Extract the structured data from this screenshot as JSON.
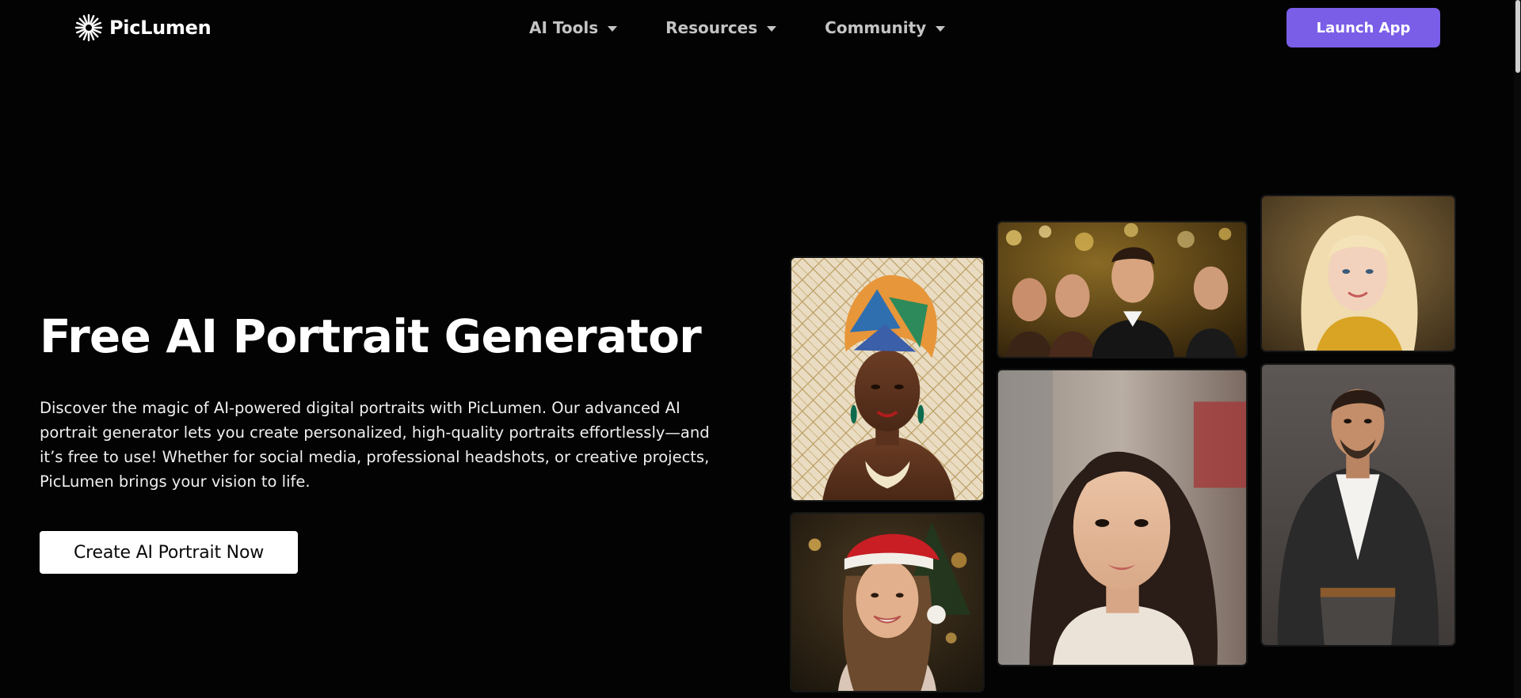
{
  "header": {
    "logo_text": "PicLumen",
    "nav": [
      {
        "label": "AI Tools"
      },
      {
        "label": "Resources"
      },
      {
        "label": "Community"
      }
    ],
    "launch_label": "Launch App"
  },
  "hero": {
    "title": "Free AI Portrait Generator",
    "description_lines": [
      "Discover the magic of AI-powered digital portraits with PicLumen. Our advanced AI",
      "portrait generator lets you create personalized, high-quality portraits effortlessly—and",
      "it’s free to use! Whether for social media, professional headshots, or creative projects,",
      "PicLumen brings your vision to life."
    ],
    "cta_label": "Create AI Portrait Now"
  },
  "colors": {
    "background": "#030303",
    "accent": "#7a5ee8",
    "nav_text": "#c4c4c4"
  },
  "icons": {
    "logo": "sunburst-icon",
    "dropdown": "caret-down-icon"
  }
}
